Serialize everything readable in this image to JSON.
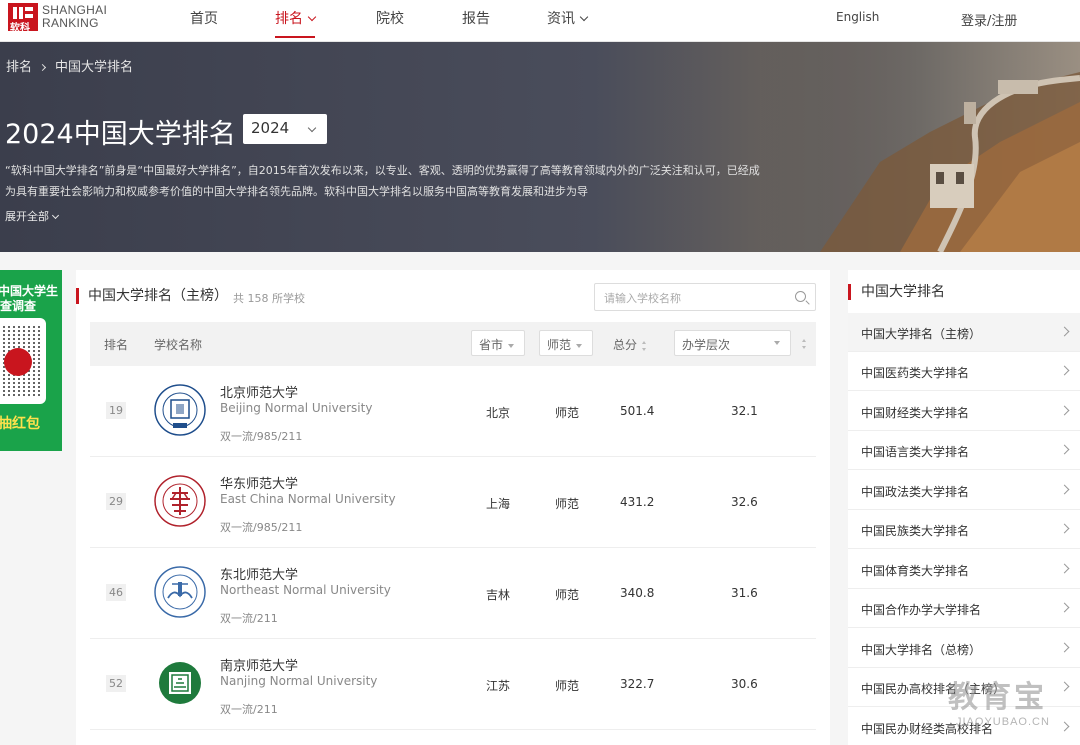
{
  "brand": {
    "logo_cn": "软科",
    "line1": "SHANGHAI",
    "line2": "RANKING"
  },
  "nav": {
    "items": [
      {
        "label": "首页"
      },
      {
        "label": "排名"
      },
      {
        "label": "院校"
      },
      {
        "label": "报告"
      },
      {
        "label": "资讯"
      }
    ],
    "active": "排名",
    "english": "English",
    "login": "登录/注册"
  },
  "breadcrumb": [
    "排名",
    "中国大学排名"
  ],
  "banner": {
    "title": "2024中国大学排名",
    "year_selected": "2024",
    "desc": "“软科中国大学排名”前身是“中国最好大学排名”，自2015年首次发布以来，以专业、客观、透明的优势赢得了高等教育领域内外的广泛关注和认可，已经成为具有重要社会影响力和权威参考价值的中国大学排名领先品牌。软科中国大学排名以服务中国高等教育发展和进步为导",
    "expand": "展开全部"
  },
  "promo": {
    "line1": "中国大学生",
    "line2": "查调查",
    "line3": "抽红包"
  },
  "ranking": {
    "title": "中国大学排名（主榜）",
    "count": "共 158 所学校",
    "search_placeholder": "请输入学校名称",
    "columns": {
      "rank": "排名",
      "name": "学校名称",
      "province": "省市",
      "type": "师范",
      "score": "总分",
      "level": "办学层次"
    },
    "rows": [
      {
        "rank": "19",
        "name": "北京师范大学",
        "en": "Beijing Normal University",
        "tags": "双一流/985/211",
        "province": "北京",
        "type": "师范",
        "score": "501.4",
        "level": "32.1"
      },
      {
        "rank": "29",
        "name": "华东师范大学",
        "en": "East China Normal University",
        "tags": "双一流/985/211",
        "province": "上海",
        "type": "师范",
        "score": "431.2",
        "level": "32.6"
      },
      {
        "rank": "46",
        "name": "东北师范大学",
        "en": "Northeast Normal University",
        "tags": "双一流/211",
        "province": "吉林",
        "type": "师范",
        "score": "340.8",
        "level": "31.6"
      },
      {
        "rank": "52",
        "name": "南京师范大学",
        "en": "Nanjing Normal University",
        "tags": "双一流/211",
        "province": "江苏",
        "type": "师范",
        "score": "322.7",
        "level": "30.6"
      }
    ]
  },
  "side": {
    "title": "中国大学排名",
    "items": [
      {
        "label": "中国大学排名（主榜）"
      },
      {
        "label": "中国医药类大学排名"
      },
      {
        "label": "中国财经类大学排名"
      },
      {
        "label": "中国语言类大学排名"
      },
      {
        "label": "中国政法类大学排名"
      },
      {
        "label": "中国民族类大学排名"
      },
      {
        "label": "中国体育类大学排名"
      },
      {
        "label": "中国合作办学大学排名"
      },
      {
        "label": "中国大学排名（总榜）"
      },
      {
        "label": "中国民办高校排名（主榜）"
      },
      {
        "label": "中国民办财经类高校排名"
      }
    ]
  },
  "watermark": {
    "cn": "教育宝",
    "url": "JIAOYUBAO.CN"
  },
  "colors": {
    "accent": "#c9151e",
    "promo": "#1aa34a"
  }
}
